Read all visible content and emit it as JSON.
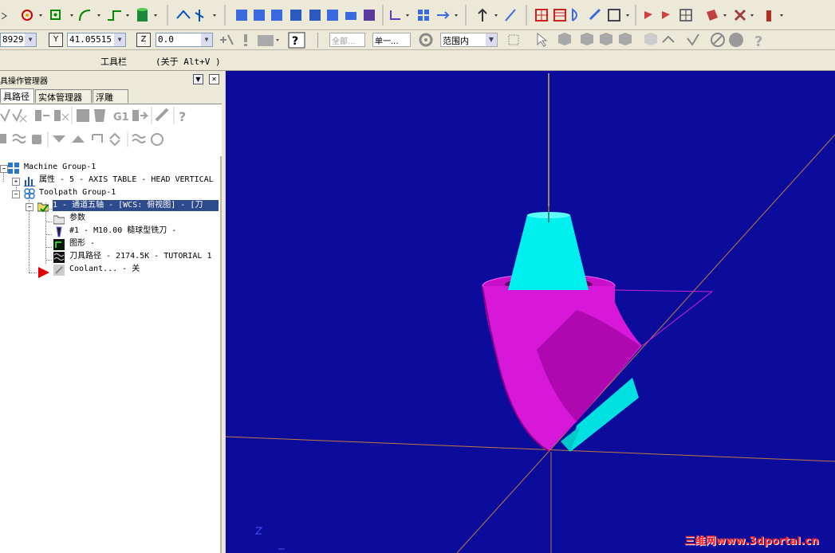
{
  "toolbar": {
    "coord_x_value": "8929:",
    "coord_y_label": "Y",
    "coord_y_value": "41.05515",
    "coord_z_label": "Z",
    "coord_z_value": "0.0",
    "help_glyph": "?",
    "level_all": "全部...",
    "level_single": "单一...",
    "range_select": "范围内",
    "label": "工具栏",
    "hint": "(关于 Alt+V )"
  },
  "panel": {
    "title": "具操作管理器",
    "tabs": [
      "具路径",
      "实体管理器",
      "浮雕"
    ]
  },
  "tree": {
    "machine_group": "Machine Group-1",
    "properties": "属性 - 5 - AXIS TABLE - HEAD VERTICAL",
    "toolpath_group": "Toolpath Group-1",
    "operation": "1 - 通道五轴 - [WCS: 俯视图] - [刀",
    "params": "参数",
    "tool": "#1 - M10.00 糙球型铣刀 -",
    "geometry": "图形 -",
    "toolpath": "刀具路径 - 2174.5K - TUTORIAL 1",
    "coolant": "Coolant... - 关"
  },
  "viewport": {
    "background": "#0b0b9c",
    "part_color": "#e010e0",
    "tool_color": "#00f0f0",
    "watermark": "三维网www.3dportal.cn"
  }
}
